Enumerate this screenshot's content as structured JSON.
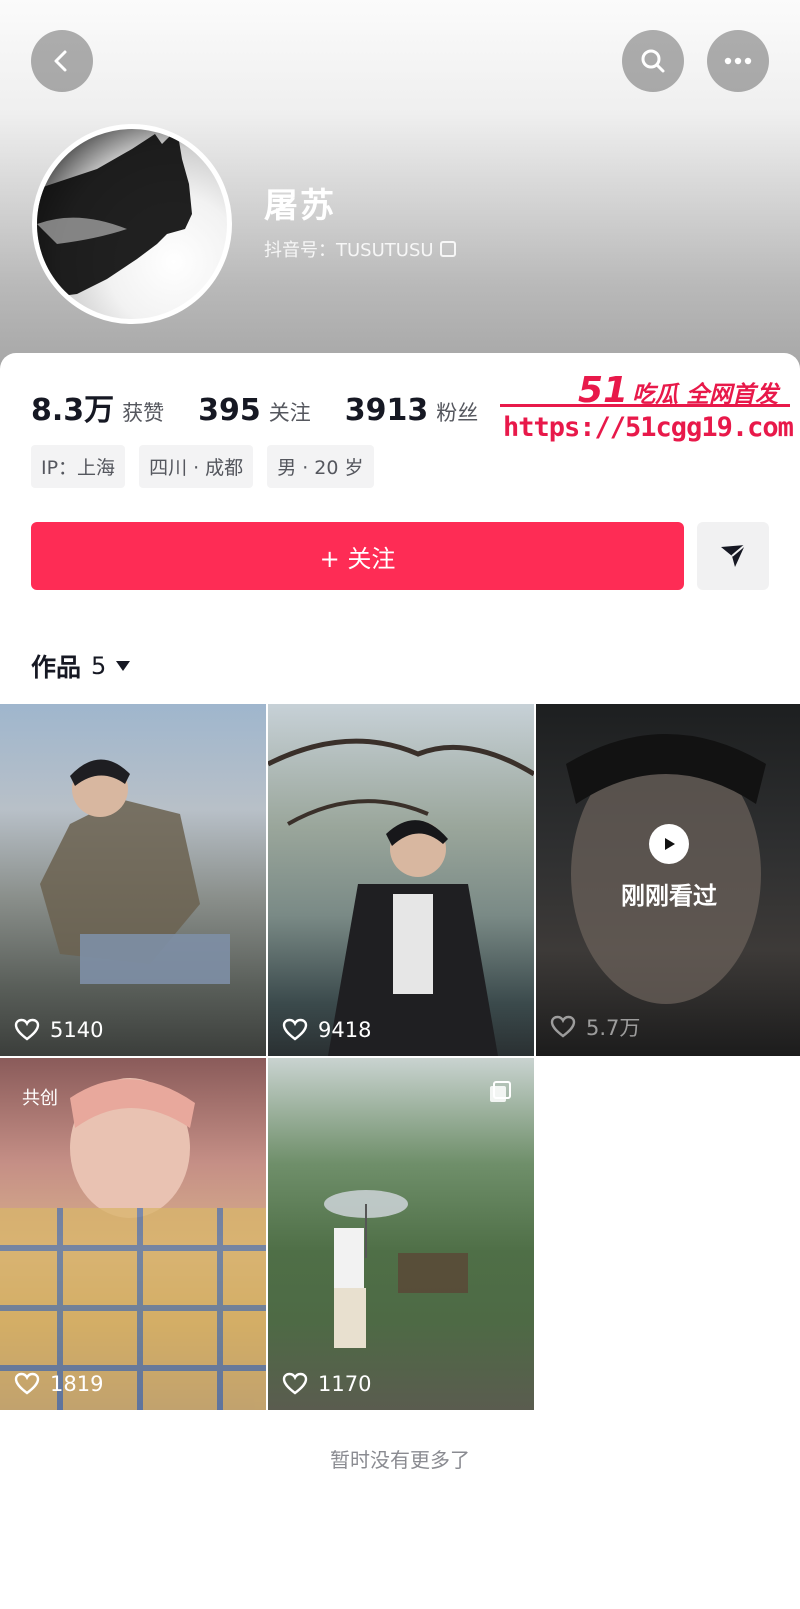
{
  "topbar": {
    "back_icon": "chevron-left-icon",
    "search_icon": "search-icon",
    "more_icon": "more-horizontal-icon"
  },
  "profile": {
    "username": "屠苏",
    "douyin_id": "抖音号：TUSUTUSU",
    "avatar_desc": "cat-silhouette-avatar"
  },
  "stats": [
    {
      "value": "8.3万",
      "label": "获赞"
    },
    {
      "value": "395",
      "label": "关注"
    },
    {
      "value": "3913",
      "label": "粉丝"
    }
  ],
  "tags": [
    "IP：上海",
    "四川 · 成都",
    "男 · 20 岁"
  ],
  "actions": {
    "follow_label": "+ 关注",
    "share_icon": "send-icon"
  },
  "works": {
    "label": "作品",
    "count": "5"
  },
  "videos": [
    {
      "likes": "5140"
    },
    {
      "likes": "9418"
    },
    {
      "likes": "5.7万",
      "overlay": "刚刚看过"
    },
    {
      "likes": "1819",
      "badge": "共创"
    },
    {
      "likes": "1170"
    }
  ],
  "footer": {
    "end_text": "暂时没有更多了"
  },
  "watermark": {
    "brand_num": "51",
    "brand_text": "吃瓜 全网首发",
    "url": "https://51cgg19.com"
  },
  "colors": {
    "accent": "#fe2c55",
    "watermark": "#e8194a"
  }
}
